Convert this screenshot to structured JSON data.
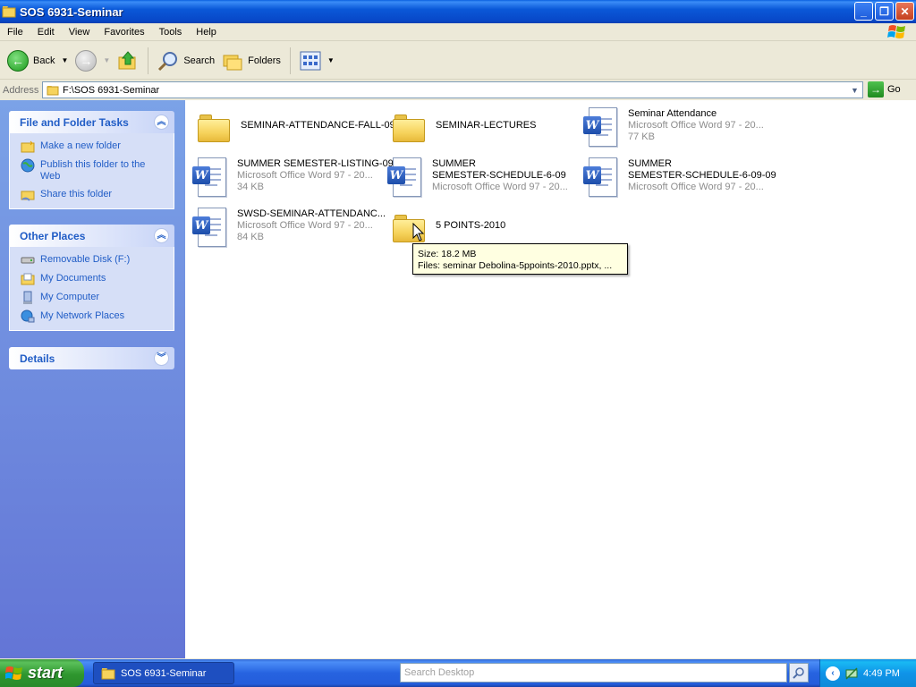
{
  "window": {
    "title": "SOS 6931-Seminar",
    "minimize": "_",
    "maximize": "❐",
    "close": "✕"
  },
  "menubar": {
    "items": [
      "File",
      "Edit",
      "View",
      "Favorites",
      "Tools",
      "Help"
    ]
  },
  "toolbar": {
    "back_label": "Back",
    "search_label": "Search",
    "folders_label": "Folders"
  },
  "address": {
    "label": "Address",
    "value": "F:\\SOS 6931-Seminar",
    "go_label": "Go"
  },
  "sidebar": {
    "file_folder_tasks": {
      "title": "File and Folder Tasks",
      "items": [
        {
          "label": "Make a new folder",
          "icon": "new-folder-icon"
        },
        {
          "label": "Publish this folder to the Web",
          "icon": "globe-icon"
        },
        {
          "label": "Share this folder",
          "icon": "share-folder-icon"
        }
      ]
    },
    "other_places": {
      "title": "Other Places",
      "items": [
        {
          "label": "Removable Disk (F:)",
          "icon": "removable-disk-icon"
        },
        {
          "label": "My Documents",
          "icon": "my-documents-icon"
        },
        {
          "label": "My Computer",
          "icon": "my-computer-icon"
        },
        {
          "label": "My Network Places",
          "icon": "network-places-icon"
        }
      ]
    },
    "details": {
      "title": "Details"
    }
  },
  "files": [
    {
      "name": "SEMINAR-ATTENDANCE-FALL-09",
      "type": "folder"
    },
    {
      "name": "SEMINAR-LECTURES",
      "type": "folder"
    },
    {
      "name": "Seminar Attendance",
      "type": "word",
      "kind": "Microsoft Office Word 97 - 20...",
      "size": "77 KB"
    },
    {
      "name": "SUMMER SEMESTER-LISTING-09",
      "type": "word",
      "kind": "Microsoft Office Word 97 - 20...",
      "size": "34 KB"
    },
    {
      "name_line1": "SUMMER",
      "name_line2": "SEMESTER-SCHEDULE-6-09",
      "type": "word",
      "kind": "Microsoft Office Word 97 - 20..."
    },
    {
      "name_line1": "SUMMER",
      "name_line2": "SEMESTER-SCHEDULE-6-09-09",
      "type": "word",
      "kind": "Microsoft Office Word 97 - 20..."
    },
    {
      "name": "SWSD-SEMINAR-ATTENDANC...",
      "type": "word",
      "kind": "Microsoft Office Word 97 - 20...",
      "size": "84 KB"
    },
    {
      "name": "5 POINTS-2010",
      "type": "folder"
    }
  ],
  "tooltip": {
    "line1": "Size: 18.2 MB",
    "line2": "Files: seminar Debolina-5ppoints-2010.pptx, ..."
  },
  "taskbar": {
    "start_label": "start",
    "task_label": "SOS 6931-Seminar",
    "search_placeholder": "Search Desktop",
    "clock": "4:49 PM"
  },
  "colors": {
    "titlebar": "#0A58D8",
    "sidebar_link": "#215DC6",
    "taskbar": "#245DDB",
    "start": "#2E962E"
  }
}
